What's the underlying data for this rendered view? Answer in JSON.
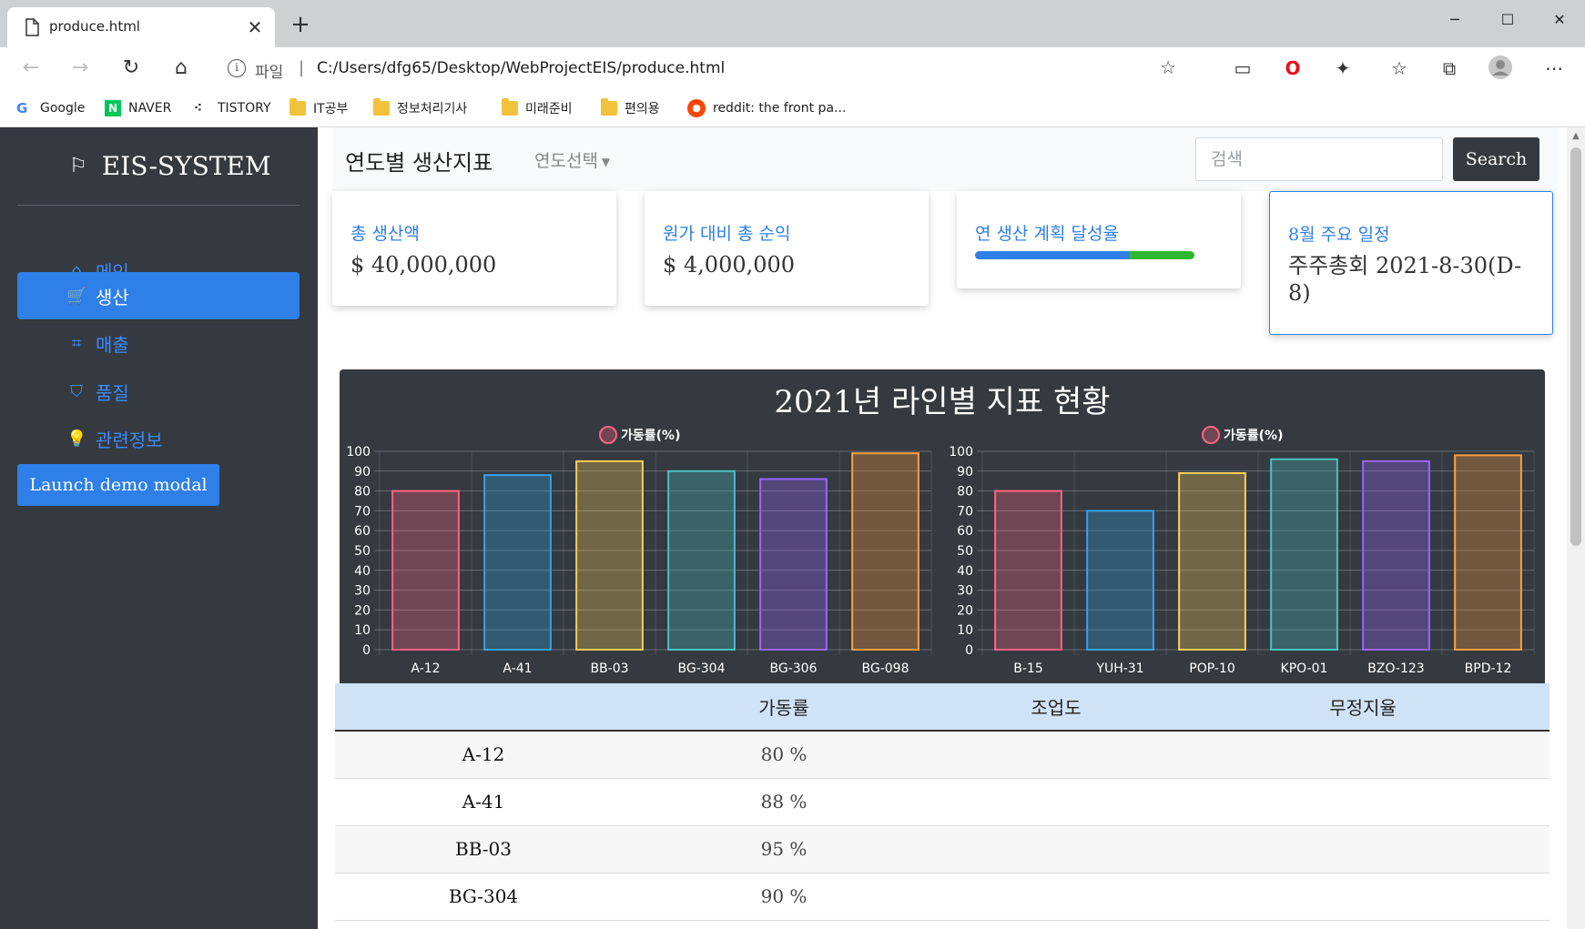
{
  "browser": {
    "tab_title": "produce.html",
    "tab_close": "✕",
    "new_tab": "+",
    "minimize": "─",
    "maximize": "☐",
    "close": "✕",
    "protocol": "파일",
    "separator": "|",
    "url": "C:/Users/dfg65/Desktop/WebProjectEIS/produce.html",
    "bookmarks": [
      {
        "label": "Google"
      },
      {
        "label": "NAVER"
      },
      {
        "label": "TISTORY"
      },
      {
        "label": "IT공부"
      },
      {
        "label": "정보처리기사"
      },
      {
        "label": "미래준비"
      },
      {
        "label": "편의용"
      },
      {
        "label": "reddit: the front pa..."
      }
    ]
  },
  "sidebar": {
    "brand": "EIS-SYSTEM",
    "items": [
      {
        "label": "메인"
      },
      {
        "label": "생산"
      },
      {
        "label": "매출"
      },
      {
        "label": "품질"
      },
      {
        "label": "관련정보"
      }
    ],
    "modal_button": "Launch demo modal"
  },
  "header": {
    "title": "연도별 생산지표",
    "year_select": "연도선택",
    "search_placeholder": "검색",
    "search_button": "Search"
  },
  "cards": [
    {
      "label": "총 생산액",
      "value": "$ 40,000,000"
    },
    {
      "label": "원가 대비 총 순익",
      "value": "$ 4,000,000"
    },
    {
      "label": "연 생산 계획 달성율",
      "progress": [
        0.7,
        0.3
      ]
    },
    {
      "label": "8월 주요 일정",
      "value": "주주총회 2021-8-30(D-8)"
    }
  ],
  "chart_data": [
    {
      "type": "bar",
      "title": "2021년 라인별 지표 현황",
      "categories": [
        "A-12",
        "A-41",
        "BB-03",
        "BG-304",
        "BG-306",
        "BG-098"
      ],
      "series": [
        {
          "name": "가동률(%)",
          "values": [
            80,
            88,
            95,
            90,
            86,
            99
          ]
        }
      ],
      "ylim": [
        0,
        100
      ],
      "yticks": [
        0,
        10,
        20,
        30,
        40,
        50,
        60,
        70,
        80,
        90,
        100
      ],
      "colors": [
        "#ff6384",
        "#36a2eb",
        "#ffce56",
        "#4bc0c0",
        "#9966ff",
        "#ff9f40"
      ],
      "legend": "top"
    },
    {
      "type": "bar",
      "categories": [
        "B-15",
        "YUH-31",
        "POP-10",
        "KPO-01",
        "BZO-123",
        "BPD-12"
      ],
      "series": [
        {
          "name": "가동률(%)",
          "values": [
            80,
            70,
            89,
            96,
            95,
            98
          ]
        }
      ],
      "ylim": [
        0,
        100
      ],
      "yticks": [
        0,
        10,
        20,
        30,
        40,
        50,
        60,
        70,
        80,
        90,
        100
      ],
      "colors": [
        "#ff6384",
        "#36a2eb",
        "#ffce56",
        "#4bc0c0",
        "#9966ff",
        "#ff9f40"
      ],
      "legend": "top"
    }
  ],
  "table": {
    "headers": [
      "",
      "가동률",
      "조업도",
      "무정지율"
    ],
    "rows": [
      {
        "name": "A-12",
        "rate": "80 %",
        "operation": "",
        "nonstop": ""
      },
      {
        "name": "A-41",
        "rate": "88 %",
        "operation": "",
        "nonstop": ""
      },
      {
        "name": "BB-03",
        "rate": "95 %",
        "operation": "",
        "nonstop": ""
      },
      {
        "name": "BG-304",
        "rate": "90 %",
        "operation": "",
        "nonstop": ""
      }
    ]
  }
}
